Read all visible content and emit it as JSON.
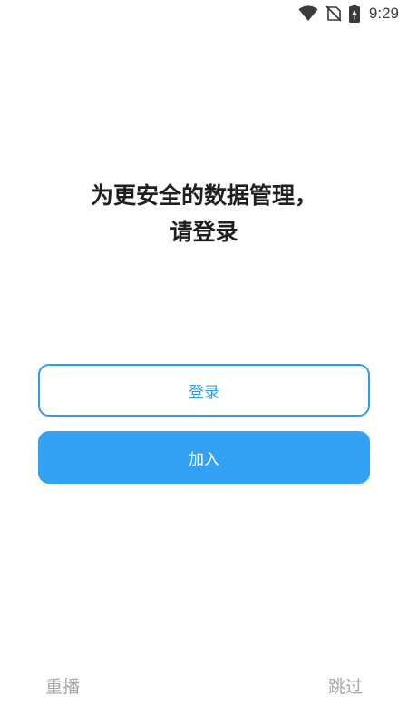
{
  "status_bar": {
    "time": "9:29",
    "icons": [
      "wifi-icon",
      "no-sim-icon",
      "battery-charging-icon"
    ]
  },
  "headline": {
    "line1": "为更安全的数据管理，",
    "line2": "请登录"
  },
  "buttons": {
    "login_label": "登录",
    "join_label": "加入"
  },
  "footer": {
    "replay_label": "重播",
    "skip_label": "跳过"
  },
  "colors": {
    "accent": "#33a2f4",
    "outline": "#2f9bf0",
    "muted_text": "#a6a6a6",
    "headline_text": "#1f1f1f"
  }
}
